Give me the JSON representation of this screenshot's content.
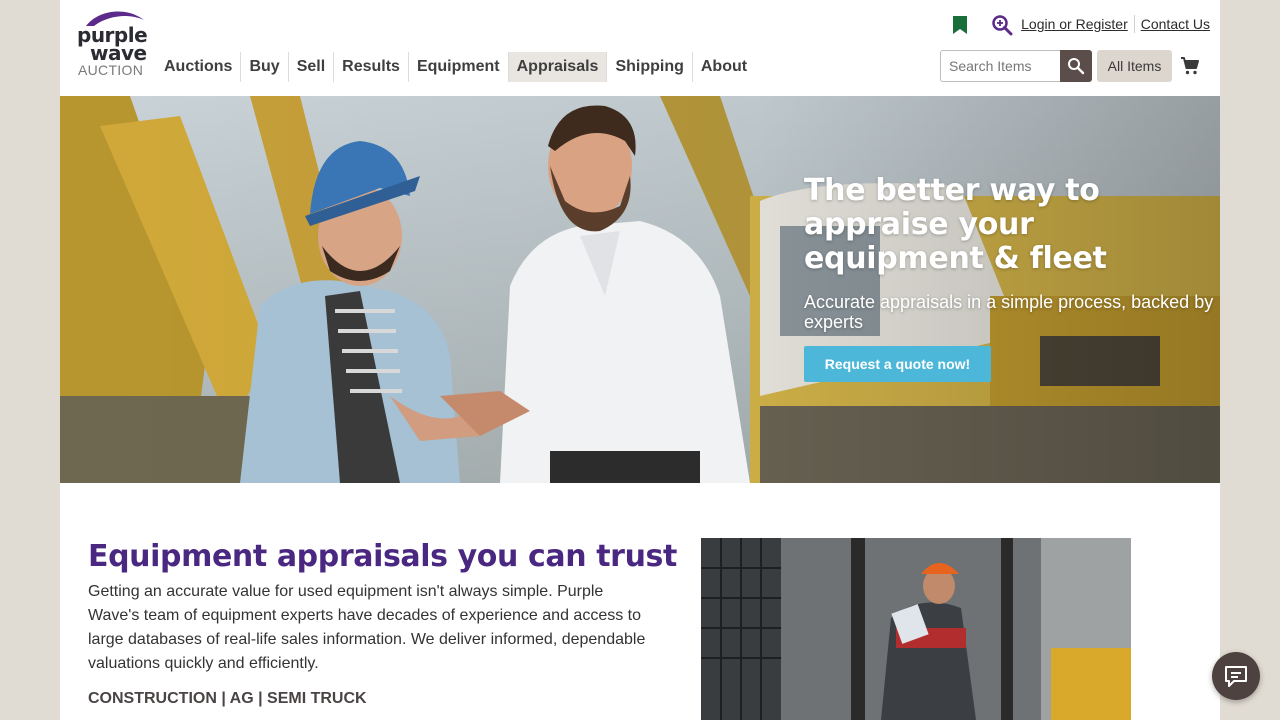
{
  "brand": {
    "logo_line1": "purple",
    "logo_line2": "wave",
    "logo_line3": "AUCTION"
  },
  "nav": {
    "items": [
      "Auctions",
      "Buy",
      "Sell",
      "Results",
      "Equipment",
      "Appraisals",
      "Shipping",
      "About"
    ],
    "active": "Appraisals"
  },
  "header": {
    "login_label": "Login or Register",
    "contact_label": "Contact Us",
    "icons": [
      "bookmark-icon",
      "search-zoom-icon",
      "cart-icon"
    ]
  },
  "search": {
    "placeholder": "Search Items",
    "value": "",
    "scope_label": "All Items"
  },
  "hero": {
    "title": "The better way to appraise your equipment & fleet",
    "subtitle": "Accurate appraisals in a simple process, backed by experts",
    "cta_label": "Request a quote now!"
  },
  "main": {
    "heading": "Equipment appraisals you can trust",
    "body": "Getting an accurate value for used equipment isn't always simple. Purple Wave's team of equipment experts have decades of experience and access to large databases of real-life sales information. We deliver informed, dependable valuations quickly and efficiently.",
    "categories": "CONSTRUCTION | AG | SEMI TRUCK"
  },
  "colors": {
    "brand_purple": "#4a2882",
    "bookmark_green": "#1a6e3a",
    "cta_blue": "#4db7da",
    "search_button": "#5a4d4a",
    "page_bg": "#e0dbd3"
  }
}
